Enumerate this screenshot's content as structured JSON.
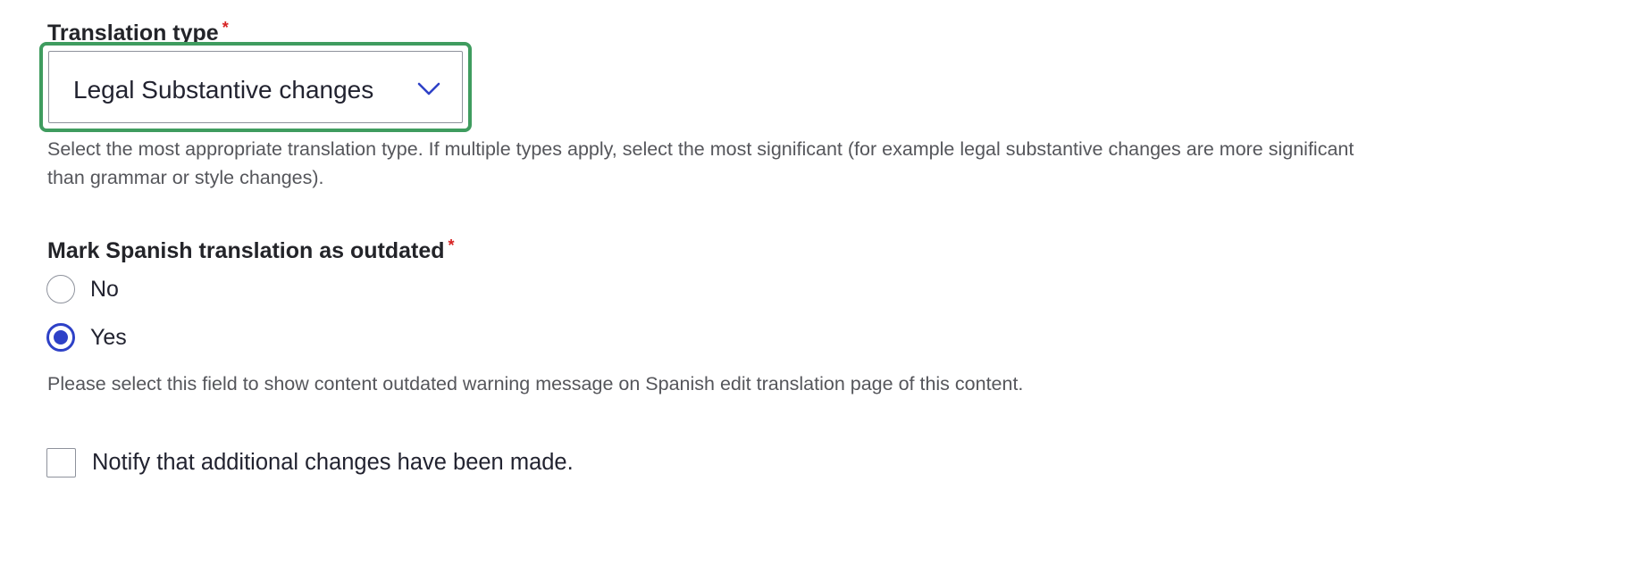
{
  "translation_type": {
    "label": "Translation type",
    "required_marker": "*",
    "selected_value": "Legal Substantive changes",
    "description_line1": "Select the most appropriate translation type. If multiple types apply, select the most significant (for example legal substantive changes are more significant",
    "description_line2": "than grammar or style changes)."
  },
  "outdated": {
    "label": "Mark Spanish translation as outdated",
    "required_marker": "*",
    "options": [
      {
        "label": "No",
        "checked": false
      },
      {
        "label": "Yes",
        "checked": true
      }
    ],
    "description": "Please select this field to show content outdated warning message on Spanish edit translation page of this content."
  },
  "notify": {
    "label": "Notify that additional changes have been made.",
    "checked": false
  },
  "colors": {
    "focus_ring": "#3f9c5f",
    "accent": "#2e41c7",
    "required": "#d72222"
  },
  "icons": {
    "select_arrow": "chevron-down-icon"
  }
}
